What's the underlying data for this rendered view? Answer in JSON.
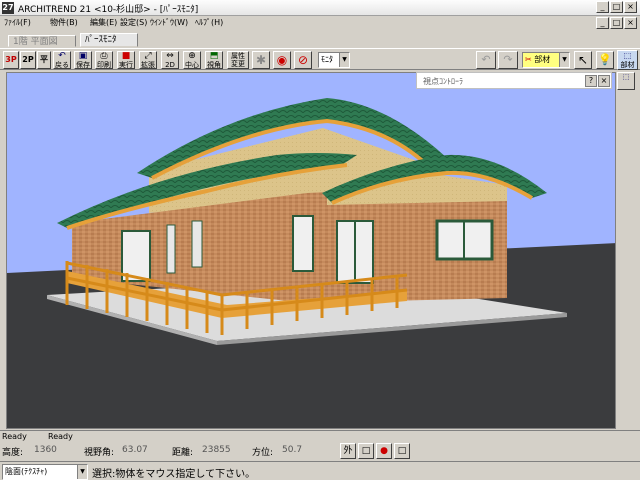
{
  "titlebar": {
    "app_icon": "27",
    "title": "ARCHITREND 21 <10-杉山邸> - [ﾊﾟｰｽﾓﾆﾀ]",
    "controls": [
      "_",
      "□",
      "×"
    ]
  },
  "menubar": {
    "items": [
      "ﾌｧｲﾙ(F)",
      "物件(B)",
      "編集(E)",
      "設定(S)",
      "ｳｲﾝﾄﾞｳ(W)",
      "ﾍﾙﾌﾟ(H)"
    ]
  },
  "tabs": [
    {
      "label": "1階 平面図",
      "active": false
    },
    {
      "label": "ﾊﾟｰｽﾓﾆﾀ",
      "active": true
    }
  ],
  "toolbar": {
    "buttons": [
      "3P",
      "2P",
      "平",
      "戻る",
      "保存",
      "印刷",
      "実行",
      "拡張",
      "2D",
      "中心",
      "視角",
      "属性変更"
    ],
    "monitor_combo": "ﾓﾆﾀ",
    "right_combo": "部材",
    "right_tool": "部材"
  },
  "panel": {
    "title": "視点ｺﾝﾄﾛｰﾗ"
  },
  "ready": [
    "Ready",
    "Ready"
  ],
  "coords": {
    "height_label": "高度:",
    "height_value": "1360",
    "fov_label": "視野角:",
    "fov_value": "63.07",
    "distance_label": "距離:",
    "distance_value": "23855",
    "direction_label": "方位:",
    "direction_value": "50.7",
    "buttons": [
      "外",
      "□",
      "●",
      "□"
    ]
  },
  "status": {
    "mode_combo": "陰面(ﾃｸｽﾁｬ)",
    "message": "選択:物体をマウス指定して下さい。"
  },
  "colors": {
    "sky": "#a0b4ff",
    "ground": "#3b3c3e",
    "roof": "#2f7a52",
    "wall": "#c48a5c",
    "deck": "#e6a13a"
  }
}
